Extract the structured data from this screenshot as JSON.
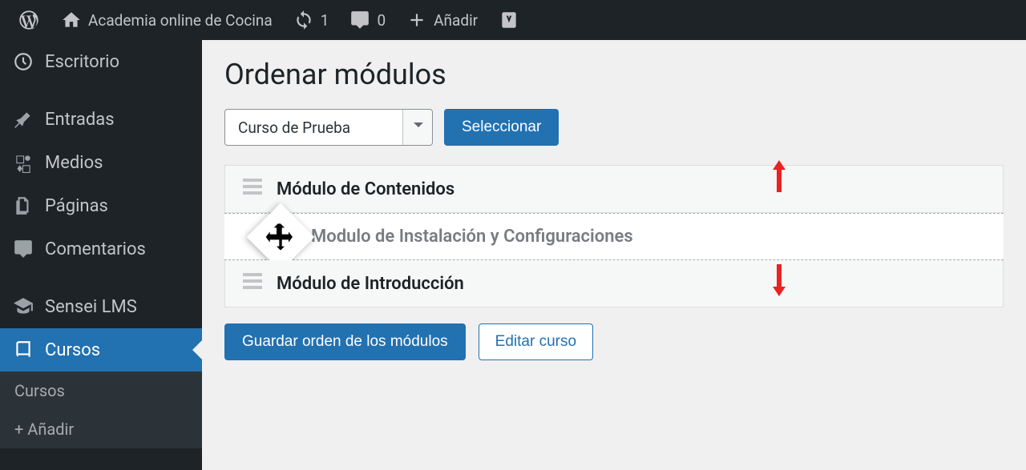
{
  "adminBar": {
    "siteTitle": "Academia online de Cocina",
    "updateCount": "1",
    "commentCount": "0",
    "addLabel": "Añadir"
  },
  "sidebar": {
    "items": [
      {
        "label": "Escritorio",
        "icon": "dashboard"
      },
      {
        "label": "Entradas",
        "icon": "pin"
      },
      {
        "label": "Medios",
        "icon": "media"
      },
      {
        "label": "Páginas",
        "icon": "pages"
      },
      {
        "label": "Comentarios",
        "icon": "comment"
      },
      {
        "label": "Sensei LMS",
        "icon": "grad-cap"
      },
      {
        "label": "Cursos",
        "icon": "book",
        "current": true
      }
    ],
    "submenu": [
      {
        "label": "Cursos"
      },
      {
        "label": "+ Añadir"
      }
    ]
  },
  "page": {
    "title": "Ordenar módulos",
    "selectedCourse": "Curso de Prueba",
    "selectBtn": "Seleccionar",
    "modules": [
      "Módulo de Contenidos",
      "Modulo de Instalación y Configuraciones",
      "Módulo de Introducción"
    ],
    "saveBtn": "Guardar orden de los módulos",
    "editBtn": "Editar curso"
  },
  "colors": {
    "accent": "#2271b1",
    "arrow": "#e92222"
  }
}
